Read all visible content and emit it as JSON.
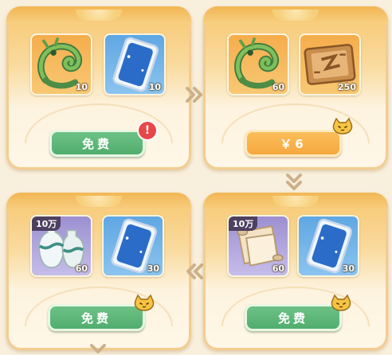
{
  "tiers": [
    {
      "items": [
        {
          "name": "jade-dragon",
          "qty": "10",
          "tag": null
        },
        {
          "name": "blue-moon-card",
          "qty": "10",
          "tag": null
        }
      ],
      "button": {
        "label": "免费",
        "style": "green"
      },
      "indicator": {
        "type": "alert",
        "text": "!"
      }
    },
    {
      "items": [
        {
          "name": "jade-dragon",
          "qty": "60",
          "tag": null
        },
        {
          "name": "bronze-plaque",
          "qty": "250",
          "tag": null
        }
      ],
      "button": {
        "label": "￥6",
        "style": "gold"
      },
      "indicator": {
        "type": "cat-icon"
      }
    },
    {
      "items": [
        {
          "name": "porcelain-vases",
          "qty": "60",
          "tag": "10万"
        },
        {
          "name": "blue-moon-card",
          "qty": "30",
          "tag": null
        }
      ],
      "button": {
        "label": "免费",
        "style": "green"
      },
      "indicator": {
        "type": "cat-icon"
      }
    },
    {
      "items": [
        {
          "name": "scroll-paper",
          "qty": "60",
          "tag": "10万"
        },
        {
          "name": "blue-moon-card",
          "qty": "30",
          "tag": null
        }
      ],
      "button": {
        "label": "免费",
        "style": "green"
      },
      "indicator": {
        "type": "cat-icon"
      }
    }
  ],
  "colors": {
    "free_button": "#4eab6c",
    "pay_button": "#f5a53b",
    "alert": "#e8474a",
    "arrow": "#cdb08a"
  },
  "flow": [
    "chevron-right",
    "chevron-down",
    "chevron-left",
    "chevron-down"
  ]
}
